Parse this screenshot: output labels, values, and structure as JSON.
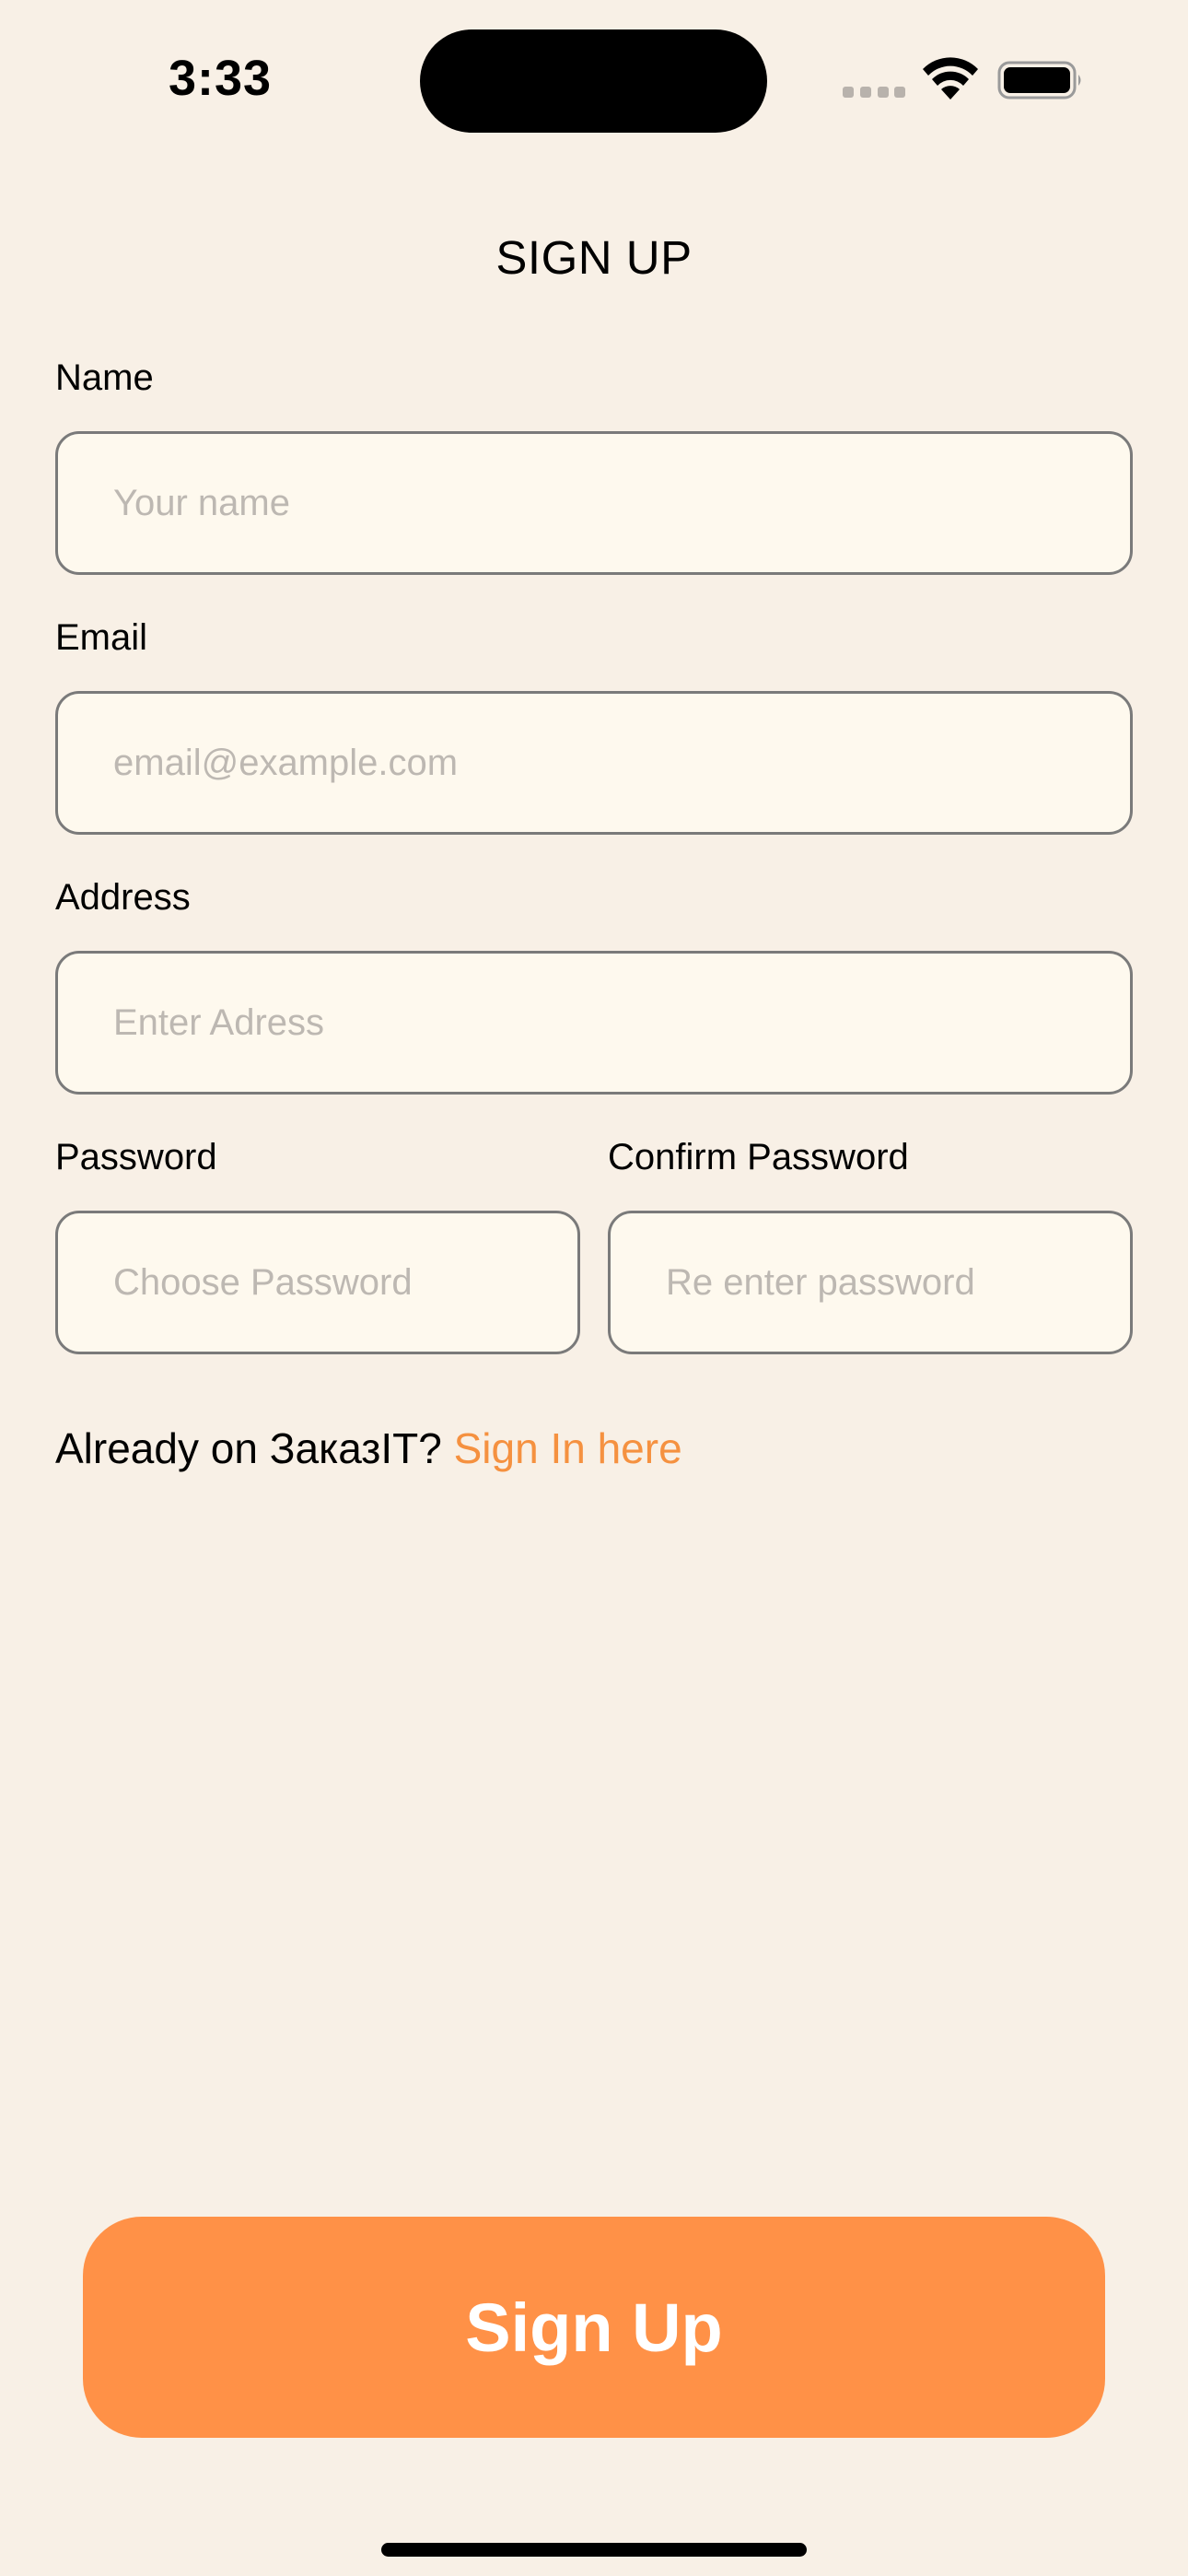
{
  "status_bar": {
    "time": "3:33"
  },
  "screen": {
    "title": "SIGN UP"
  },
  "form": {
    "name": {
      "label": "Name",
      "placeholder": "Your name",
      "value": ""
    },
    "email": {
      "label": "Email",
      "placeholder": "email@example.com",
      "value": ""
    },
    "address": {
      "label": "Address",
      "placeholder": "Enter Adress",
      "value": ""
    },
    "password": {
      "label": "Password",
      "placeholder": "Choose Password",
      "value": ""
    },
    "confirm_password": {
      "label": "Confirm Password",
      "placeholder": "Re enter password",
      "value": ""
    }
  },
  "signin_prompt": {
    "text": "Already on ЗаказIT? ",
    "link": "Sign In here"
  },
  "signup_button": {
    "label": "Sign Up"
  },
  "icons": {
    "signal": "cellular-signal-icon",
    "wifi": "wifi-icon",
    "battery": "battery-icon"
  },
  "colors": {
    "background": "#F8F0E6",
    "input_background": "#FEF9EE",
    "accent": "#FF9147",
    "link": "#F59140",
    "placeholder": "#BDB8B2"
  }
}
